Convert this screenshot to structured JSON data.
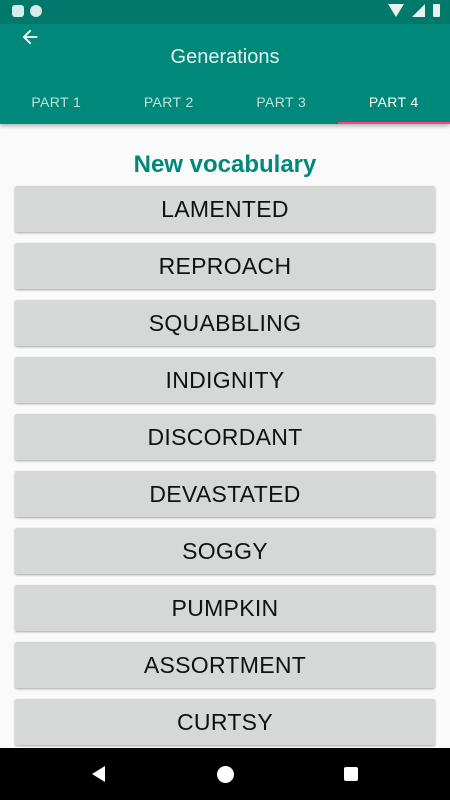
{
  "app_bar": {
    "title": "Generations",
    "back_icon": "arrow-back-icon",
    "color": "#00897b"
  },
  "tabs": [
    {
      "label": "PART 1",
      "active": false
    },
    {
      "label": "PART 2",
      "active": false
    },
    {
      "label": "PART 3",
      "active": false
    },
    {
      "label": "PART 4",
      "active": true
    }
  ],
  "main": {
    "heading": "New vocabulary",
    "words": [
      "LAMENTED",
      "REPROACH",
      "SQUABBLING",
      "INDIGNITY",
      "DISCORDANT",
      "DEVASTATED",
      "SOGGY",
      "PUMPKIN",
      "ASSORTMENT",
      "CURTSY"
    ]
  },
  "nav_bar": {
    "back_icon": "back-icon",
    "home_icon": "home-icon",
    "recents_icon": "recents-icon"
  },
  "colors": {
    "accent": "#00897b",
    "tab_indicator": "#ff4081",
    "word_button": "#d6d7d7"
  }
}
